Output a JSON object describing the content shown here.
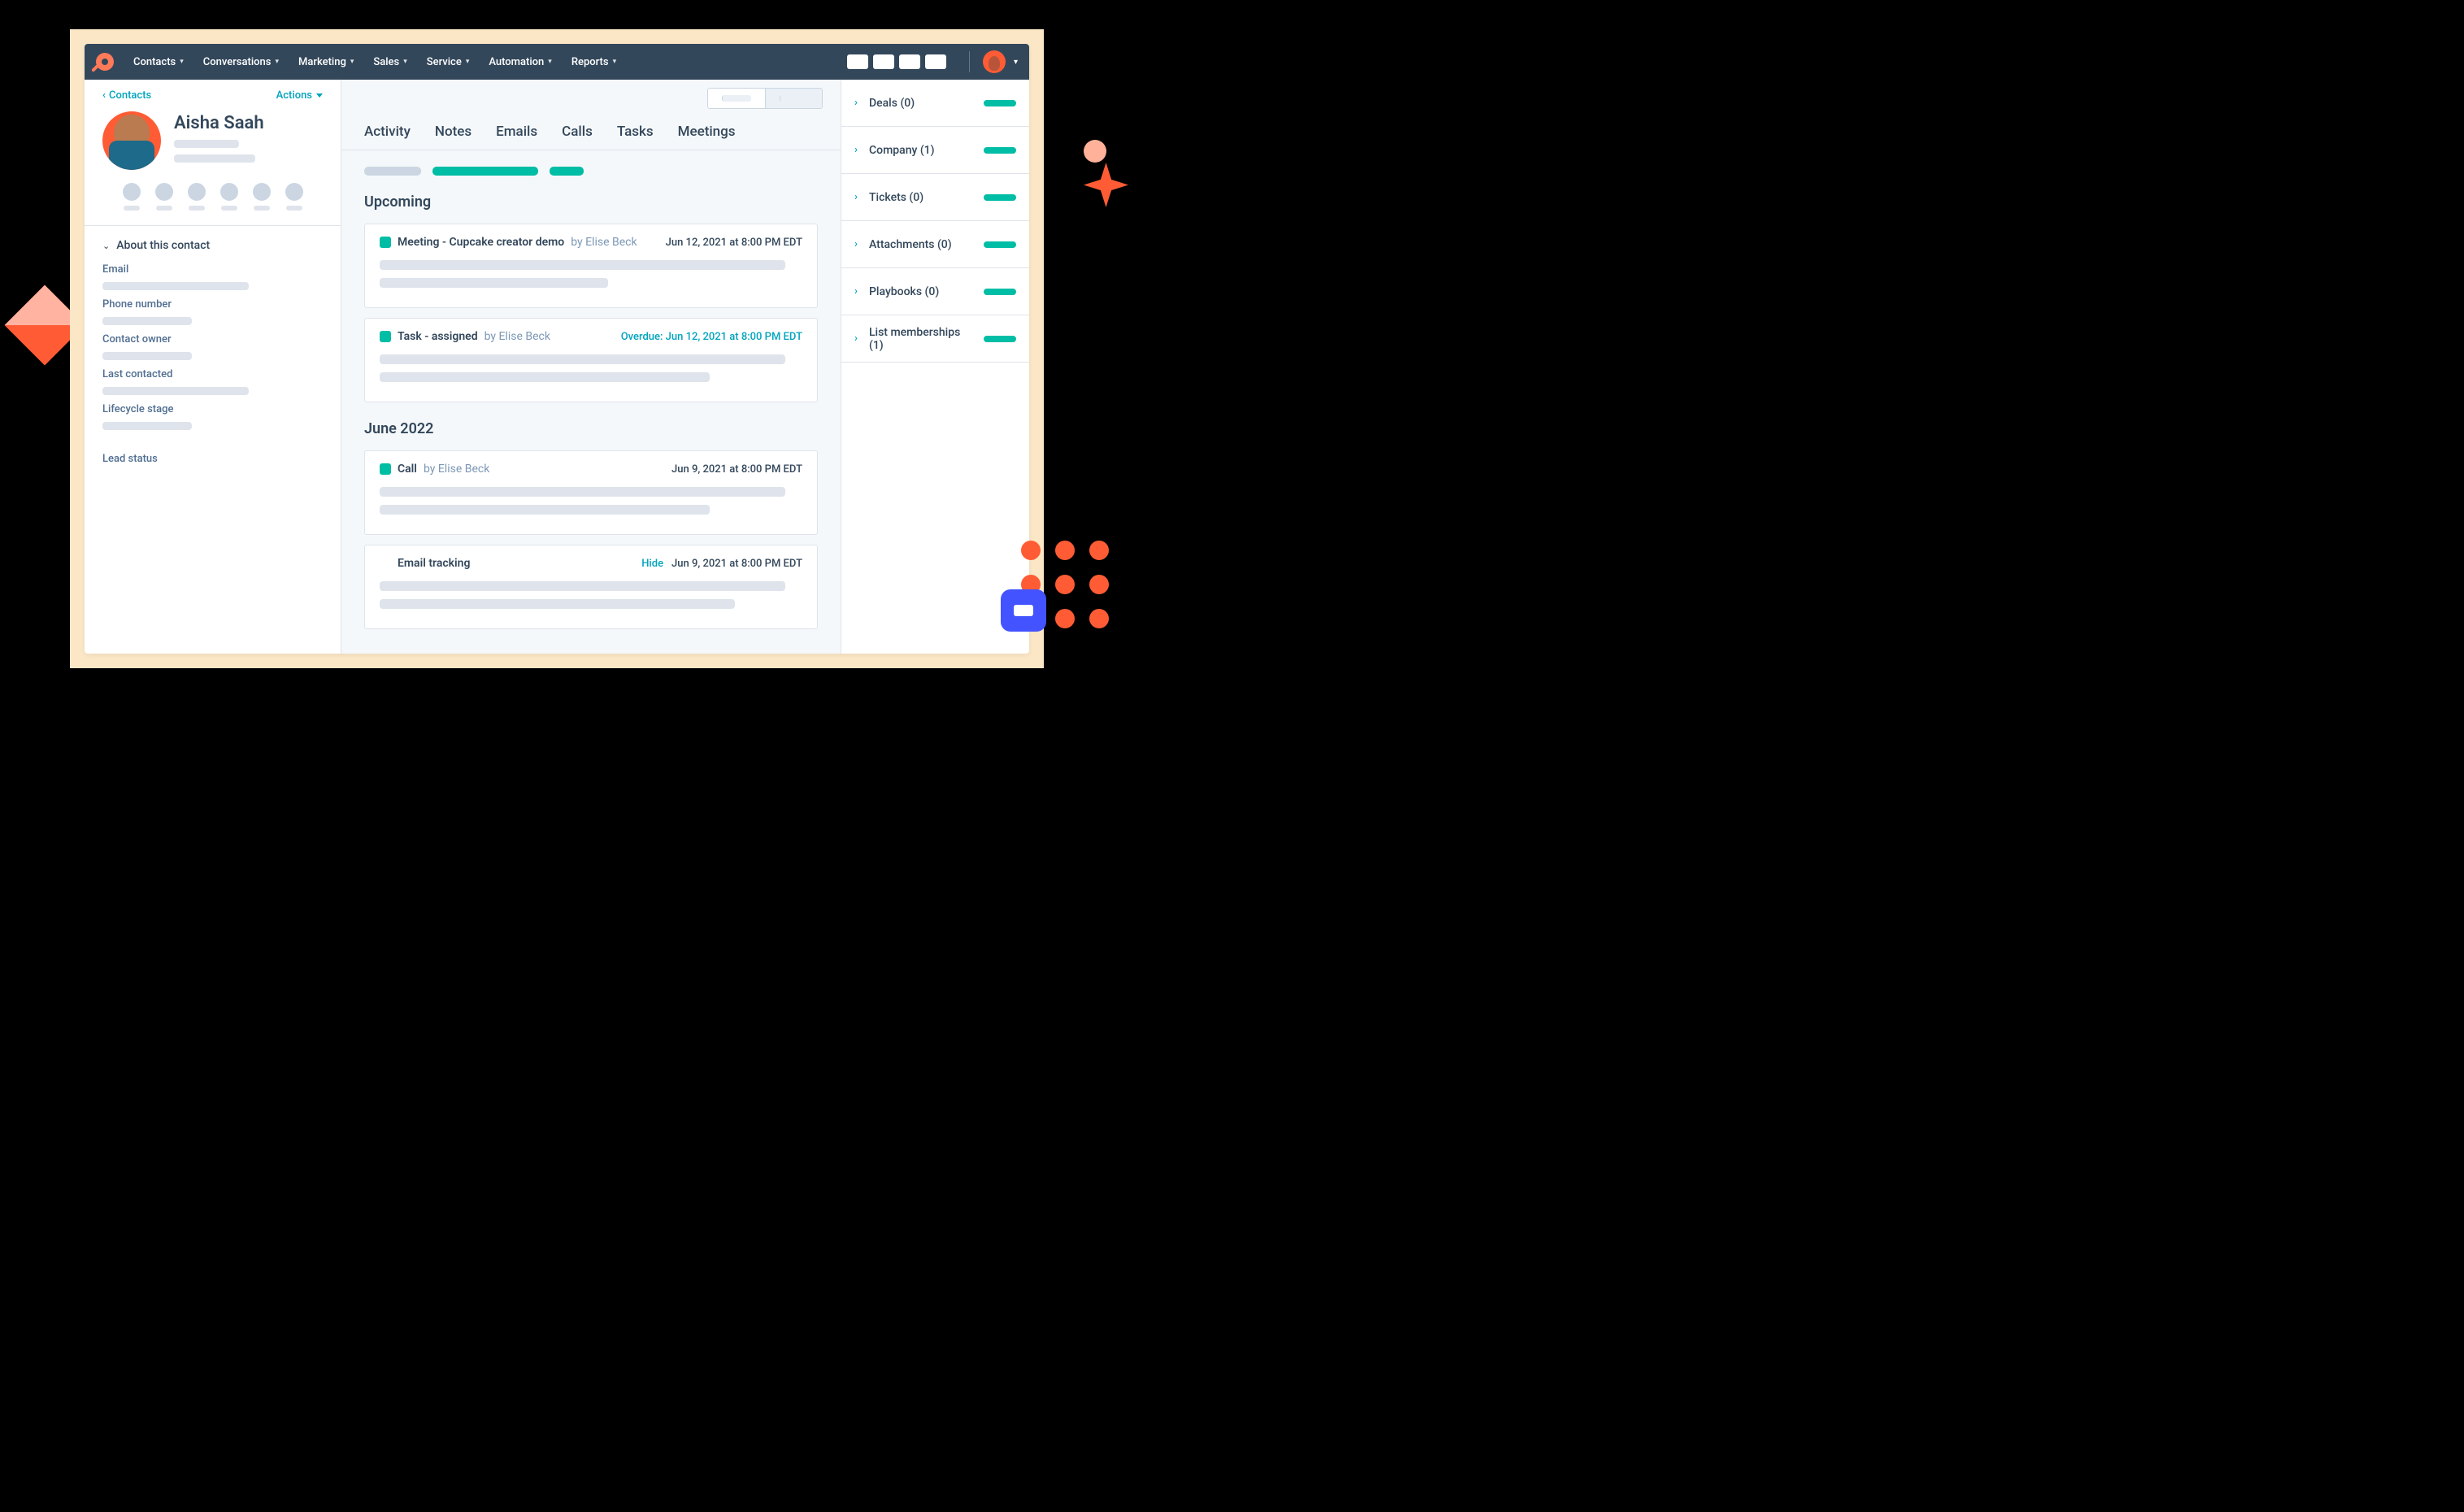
{
  "nav": {
    "items": [
      "Contacts",
      "Conversations",
      "Marketing",
      "Sales",
      "Service",
      "Automation",
      "Reports"
    ]
  },
  "sidebar": {
    "back_label": "Contacts",
    "actions_label": "Actions",
    "contact_name": "Aisha Saah",
    "about_label": "About this contact",
    "fields": [
      {
        "label": "Email"
      },
      {
        "label": "Phone number"
      },
      {
        "label": "Contact owner"
      },
      {
        "label": "Last contacted"
      },
      {
        "label": "Lifecycle stage"
      },
      {
        "label": "Lead status"
      }
    ]
  },
  "tabs": [
    "Activity",
    "Notes",
    "Emails",
    "Calls",
    "Tasks",
    "Meetings"
  ],
  "sections": {
    "upcoming_label": "Upcoming",
    "month_label": "June 2022"
  },
  "cards": {
    "upcoming": [
      {
        "title": "Meeting - Cupcake creator demo",
        "by": "by Elise Beck",
        "date": "Jun 12, 2021 at 8:00 PM EDT",
        "type": "normal"
      },
      {
        "title": "Task - assigned",
        "by": "by Elise Beck",
        "date": "Overdue: Jun 12, 2021 at 8:00 PM EDT",
        "type": "overdue"
      }
    ],
    "month": [
      {
        "title": "Call",
        "by": "by Elise Beck",
        "date": "Jun 9, 2021 at 8:00 PM EDT",
        "type": "normal"
      },
      {
        "title": "Email tracking",
        "by": "",
        "hide_label": "Hide",
        "date": "Jun 9, 2021 at 8:00 PM EDT",
        "type": "hide"
      }
    ]
  },
  "rightpanel": [
    {
      "label": "Deals (0)"
    },
    {
      "label": "Company (1)"
    },
    {
      "label": "Tickets (0)"
    },
    {
      "label": "Attachments (0)"
    },
    {
      "label": "Playbooks (0)"
    },
    {
      "label": "List memberships (1)"
    }
  ]
}
